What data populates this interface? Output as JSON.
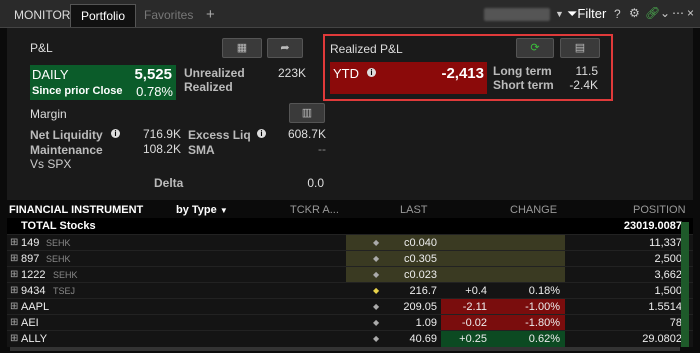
{
  "tabs": [
    "MONITOR",
    "Portfolio",
    "Favorites"
  ],
  "toolbar": {
    "plus": "+",
    "filter": "Filter",
    "help": "?"
  },
  "pnl": {
    "title": "P&L",
    "daily_label": "DAILY",
    "daily_value": "5,525",
    "since_prior_close_label": "Since prior Close",
    "since_prior_close_value": "0.78%",
    "unrealized_label": "Unrealized",
    "unrealized_value": "223K",
    "realized_label": "Realized"
  },
  "realized_pnl": {
    "title": "Realized P&L",
    "ytd_label": "YTD",
    "ytd_value": "-2,413",
    "long_term_label": "Long term",
    "long_term_value": "11.5",
    "short_term_label": "Short term",
    "short_term_value": "-2.4K"
  },
  "margin": {
    "title": "Margin",
    "net_liquidity_label": "Net Liquidity",
    "net_liquidity_value": "716.9K",
    "excess_liq_label": "Excess Liq",
    "excess_liq_value": "608.7K",
    "maintenance_label": "Maintenance",
    "maintenance_value": "108.2K",
    "sma_label": "SMA",
    "sma_value": "--",
    "vs_spx_label": "Vs SPX",
    "delta_label": "Delta",
    "delta_value": "0.0"
  },
  "table": {
    "headers": {
      "instrument": "FINANCIAL INSTRUMENT",
      "by_type": "by Type",
      "tckr": "TCKR A...",
      "last": "LAST",
      "change": "CHANGE",
      "position": "POSITION"
    },
    "total_label": "TOTAL Stocks",
    "total_position": "23019.0087",
    "rows": [
      {
        "name": "149",
        "exch": "SEHK",
        "last": "c0.040",
        "chg": "",
        "pct": "",
        "pos": "11,337",
        "tone": "olive"
      },
      {
        "name": "897",
        "exch": "SEHK",
        "last": "c0.305",
        "chg": "",
        "pct": "",
        "pos": "2,500",
        "tone": "olive"
      },
      {
        "name": "1222",
        "exch": "SEHK",
        "last": "c0.023",
        "chg": "",
        "pct": "",
        "pos": "3,662",
        "tone": "olive"
      },
      {
        "name": "9434",
        "exch": "TSEJ",
        "last": "216.7",
        "chg": "+0.4",
        "pct": "0.18%",
        "pos": "1,500",
        "tone": "none"
      },
      {
        "name": "AAPL",
        "exch": "",
        "last": "209.05",
        "chg": "-2.11",
        "pct": "-1.00%",
        "pos": "1.5514",
        "tone": "red"
      },
      {
        "name": "AEI",
        "exch": "",
        "last": "1.09",
        "chg": "-0.02",
        "pct": "-1.80%",
        "pos": "78",
        "tone": "red"
      },
      {
        "name": "ALLY",
        "exch": "",
        "last": "40.69",
        "chg": "+0.25",
        "pct": "0.62%",
        "pos": "29.0802",
        "tone": "green"
      }
    ]
  }
}
